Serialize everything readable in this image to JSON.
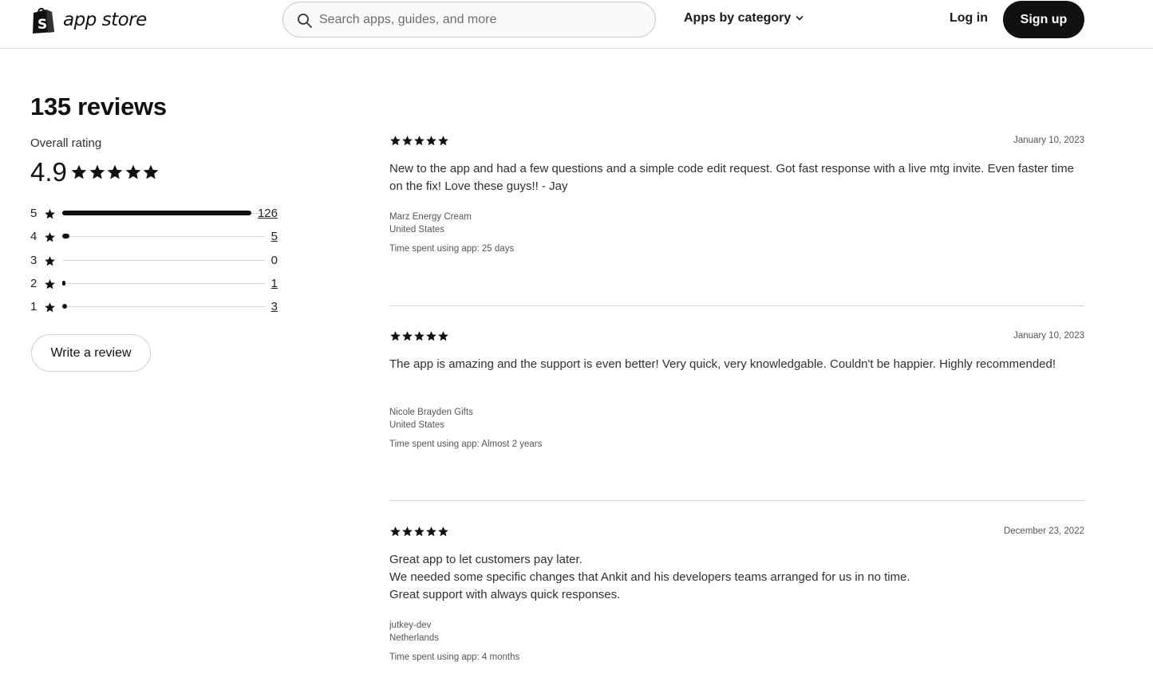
{
  "header": {
    "logo_text": "app store",
    "search_placeholder": "Search apps, guides, and more",
    "category_label": "Apps by category",
    "login_label": "Log in",
    "signup_label": "Sign up"
  },
  "summary": {
    "title": "135 reviews",
    "overall_label": "Overall rating",
    "overall_value": "4.9",
    "distribution": [
      {
        "stars": "5",
        "count": "126",
        "fraction": 0.933,
        "linked": true
      },
      {
        "stars": "4",
        "count": "5",
        "fraction": 0.037,
        "linked": true
      },
      {
        "stars": "3",
        "count": "0",
        "fraction": 0.0,
        "linked": false
      },
      {
        "stars": "2",
        "count": "1",
        "fraction": 0.007,
        "linked": true
      },
      {
        "stars": "1",
        "count": "3",
        "fraction": 0.022,
        "linked": true
      }
    ],
    "write_review_label": "Write a review"
  },
  "reviews": [
    {
      "rating": 5,
      "date": "January 10, 2023",
      "body": [
        "New to the app and had a few questions and a simple code edit request. Got fast response with a live mtg invite. Even faster time on the fix! Love these guys!! - Jay"
      ],
      "store": "Marz Energy Cream",
      "country": "United States",
      "time_spent": "Time spent using app: 25 days"
    },
    {
      "rating": 5,
      "date": "January 10, 2023",
      "body": [
        "The app is amazing and the support is even better! Very quick, very knowledgable. Couldn't be happier. Highly recommended!"
      ],
      "store": "Nicole Brayden Gifts",
      "country": "United States",
      "time_spent": "Time spent using app: Almost 2 years"
    },
    {
      "rating": 5,
      "date": "December 23, 2022",
      "body": [
        "Great app to let customers pay later.",
        "We needed some specific changes that Ankit and his developers teams arranged for us in no time.",
        "Great support with always quick responses."
      ],
      "store": "jutkey-dev",
      "country": "Netherlands",
      "time_spent": "Time spent using app: 4 months"
    }
  ]
}
